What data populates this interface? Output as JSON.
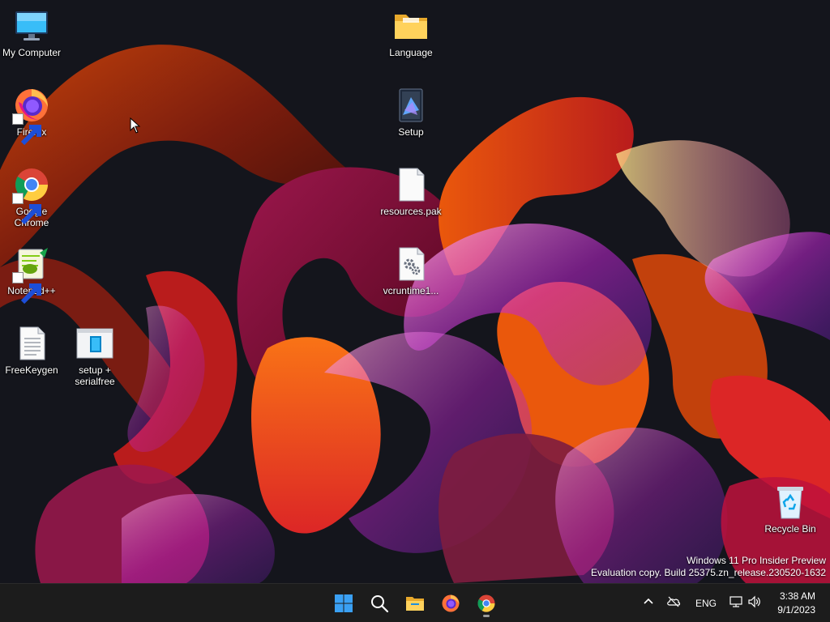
{
  "desktop_icons": {
    "my_computer": {
      "label": "My Computer",
      "icon": "monitor-icon"
    },
    "firefox": {
      "label": "Firefox",
      "icon": "firefox-icon"
    },
    "google_chrome": {
      "label": "Google Chrome",
      "icon": "chrome-icon"
    },
    "notepadpp": {
      "label": "Notepad++",
      "icon": "notepadpp-icon"
    },
    "freekeygen": {
      "label": "FreeKeygen",
      "icon": "text-file-icon"
    },
    "setup_serialfree": {
      "label": "setup + serialfree",
      "icon": "setup-window-icon"
    },
    "language": {
      "label": "Language",
      "icon": "folder-icon"
    },
    "setup": {
      "label": "Setup",
      "icon": "installer-icon"
    },
    "resources_pak": {
      "label": "resources.pak",
      "icon": "blank-file-icon"
    },
    "vcruntime": {
      "label": "vcruntime1...",
      "icon": "dll-gear-file-icon"
    },
    "recycle_bin": {
      "label": "Recycle Bin",
      "icon": "recycle-bin-icon"
    }
  },
  "watermark": {
    "line1": "Windows 11 Pro Insider Preview",
    "line2": "Evaluation copy. Build 25375.zn_release.230520-1632"
  },
  "taskbar": {
    "items": [
      {
        "name": "start",
        "icon": "windows-start-icon"
      },
      {
        "name": "search",
        "icon": "search-icon"
      },
      {
        "name": "file-explorer",
        "icon": "folder-icon"
      },
      {
        "name": "firefox",
        "icon": "firefox-icon"
      },
      {
        "name": "chrome",
        "icon": "chrome-icon",
        "running": true
      }
    ],
    "tray": {
      "language": "ENG",
      "icons": [
        "chevron-up-icon",
        "cloud-offline-icon",
        "network-icon",
        "volume-icon"
      ]
    },
    "clock": {
      "time": "3:38 AM",
      "date": "9/1/2023"
    }
  },
  "colors": {
    "taskbar_bg": "#1c1c1c",
    "wallpaper_bg": "#14151c",
    "windows_blue": "#0078d4"
  }
}
